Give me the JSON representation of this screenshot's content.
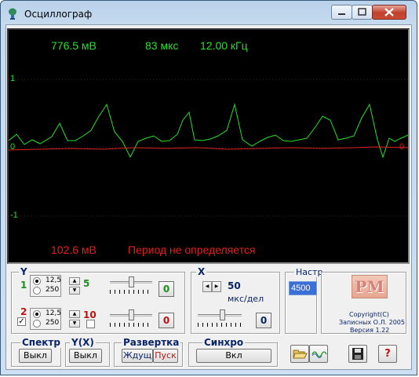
{
  "window": {
    "title": "Осциллограф"
  },
  "screen": {
    "top_left_value": "776.5 мВ",
    "top_mid_value": "83 мкс",
    "top_right_value": "12.00 кГц",
    "bottom_left_value": "102.6 мВ",
    "bottom_status": "Период не определяется",
    "axis_top": "1",
    "axis_mid": "0",
    "axis_bottom": "-1",
    "axis_mid_right": "0",
    "colors": {
      "channel1": "#24e024",
      "channel2": "#e02020",
      "background": "#000000"
    }
  },
  "y_panel": {
    "title": "Y",
    "ch1_label": "1",
    "ch2_label": "2",
    "scale_a": "12,5",
    "scale_b": "250",
    "ch2_scale_a": "12,5",
    "ch2_scale_b": "250",
    "ch1_gain": "5",
    "ch2_gain": "10",
    "ch1_offset_button": "0",
    "ch2_offset_button": "0"
  },
  "x_panel": {
    "title": "X",
    "value": "50",
    "unit": "мкс/дел",
    "offset_button": "0"
  },
  "settings": {
    "title": "Настр",
    "value": "4500"
  },
  "logo": {
    "text": "PM",
    "copyright": "Copyright(C)",
    "author": "Записных О.Л. 2005",
    "version": "Версия 1.22"
  },
  "bottom": {
    "spectr_title": "Спектр",
    "spectr_button": "Выкл",
    "yx_title": "Y(X)",
    "yx_button": "Выкл",
    "sweep_title": "Развертка",
    "sweep_wait": "Ждущ",
    "sweep_start": "Пуск",
    "sync_title": "Синхро",
    "sync_button": "Вкл",
    "help_button": "?"
  },
  "icons": [
    "app-icon",
    "minimize-icon",
    "maximize-icon",
    "close-icon",
    "open-folder-icon",
    "waveform-icon",
    "save-disk-icon",
    "help-icon"
  ]
}
